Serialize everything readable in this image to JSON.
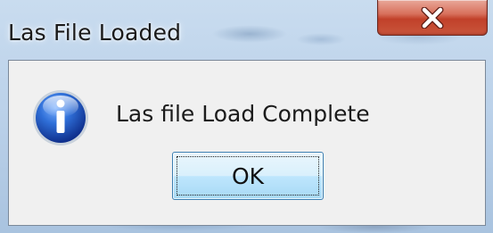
{
  "window": {
    "title": "Las File Loaded",
    "close_label": "X"
  },
  "dialog": {
    "icon": "information-icon",
    "message": "Las file Load Complete",
    "ok_label": "OK"
  },
  "colors": {
    "close_button": "#c9553c",
    "info_icon": "#2a5fc7",
    "ok_button_border": "#3c7fb1",
    "client_background": "#f0f0f0"
  }
}
